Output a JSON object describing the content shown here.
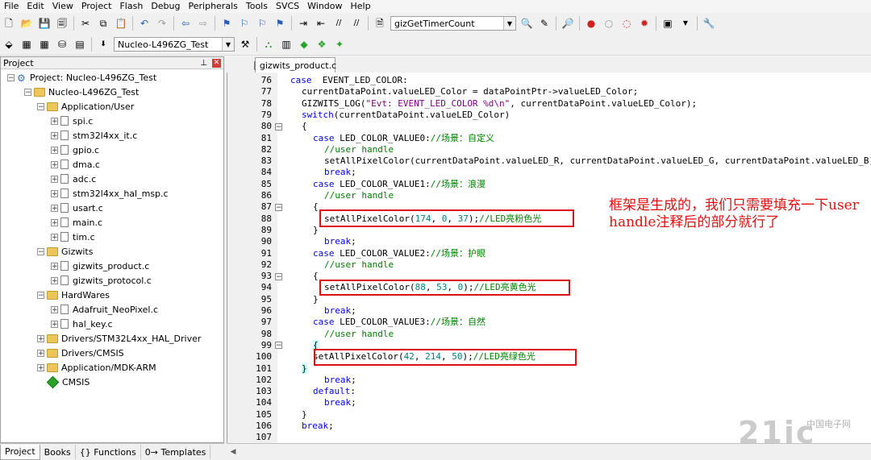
{
  "menubar": {
    "items": [
      "File",
      "Edit",
      "View",
      "Project",
      "Flash",
      "Debug",
      "Peripherals",
      "Tools",
      "SVCS",
      "Window",
      "Help"
    ]
  },
  "toolbar": {
    "function_combo": "gizGetTimerCount",
    "target_combo": "Nucleo-L496ZG_Test"
  },
  "project_panel": {
    "title": "Project",
    "tree": [
      {
        "label": "Project: Nucleo-L496ZG_Test",
        "level": 0,
        "kind": "project",
        "exp": "-"
      },
      {
        "label": "Nucleo-L496ZG_Test",
        "level": 1,
        "kind": "target",
        "exp": "-"
      },
      {
        "label": "Application/User",
        "level": 2,
        "kind": "folder",
        "exp": "-"
      },
      {
        "label": "spi.c",
        "level": 3,
        "kind": "file",
        "exp": "+"
      },
      {
        "label": "stm32l4xx_it.c",
        "level": 3,
        "kind": "file",
        "exp": "+"
      },
      {
        "label": "gpio.c",
        "level": 3,
        "kind": "file",
        "exp": "+"
      },
      {
        "label": "dma.c",
        "level": 3,
        "kind": "file",
        "exp": "+"
      },
      {
        "label": "adc.c",
        "level": 3,
        "kind": "file",
        "exp": "+"
      },
      {
        "label": "stm32l4xx_hal_msp.c",
        "level": 3,
        "kind": "file",
        "exp": "+"
      },
      {
        "label": "usart.c",
        "level": 3,
        "kind": "file",
        "exp": "+"
      },
      {
        "label": "main.c",
        "level": 3,
        "kind": "file",
        "exp": "+"
      },
      {
        "label": "tim.c",
        "level": 3,
        "kind": "file",
        "exp": "+"
      },
      {
        "label": "Gizwits",
        "level": 2,
        "kind": "folder",
        "exp": "-"
      },
      {
        "label": "gizwits_product.c",
        "level": 3,
        "kind": "file",
        "exp": "+"
      },
      {
        "label": "gizwits_protocol.c",
        "level": 3,
        "kind": "file",
        "exp": "+"
      },
      {
        "label": "HardWares",
        "level": 2,
        "kind": "folder",
        "exp": "-"
      },
      {
        "label": "Adafruit_NeoPixel.c",
        "level": 3,
        "kind": "file",
        "exp": "+"
      },
      {
        "label": "hal_key.c",
        "level": 3,
        "kind": "file",
        "exp": "+"
      },
      {
        "label": "Drivers/STM32L4xx_HAL_Driver",
        "level": 2,
        "kind": "folder",
        "exp": "+"
      },
      {
        "label": "Drivers/CMSIS",
        "level": 2,
        "kind": "folder",
        "exp": "+"
      },
      {
        "label": "Application/MDK-ARM",
        "level": 2,
        "kind": "folder",
        "exp": "+"
      },
      {
        "label": "CMSIS",
        "level": 2,
        "kind": "diamond",
        "exp": ""
      }
    ]
  },
  "bottom_tabs": [
    "Project",
    "Books",
    "{} Functions",
    "0→ Templates"
  ],
  "editor": {
    "tab_label": "gizwits_product.c",
    "lines": [
      {
        "n": "76",
        "fold": "",
        "indent": 0,
        "parts": [
          [
            "kw",
            "case"
          ],
          [
            "",
            "  EVENT_LED_COLOR:"
          ]
        ]
      },
      {
        "n": "77",
        "fold": "",
        "indent": 1,
        "parts": [
          [
            "",
            "currentDataPoint.valueLED_Color = dataPointPtr->valueLED_Color;"
          ]
        ]
      },
      {
        "n": "78",
        "fold": "",
        "indent": 1,
        "parts": [
          [
            "",
            "GIZWITS_LOG("
          ],
          [
            "str",
            "\"Evt: EVENT_LED_COLOR %d\\n\""
          ],
          [
            "",
            ", currentDataPoint.valueLED_Color);"
          ]
        ]
      },
      {
        "n": "79",
        "fold": "",
        "indent": 1,
        "parts": [
          [
            "kw",
            "switch"
          ],
          [
            "",
            "(currentDataPoint.valueLED_Color)"
          ]
        ]
      },
      {
        "n": "80",
        "fold": "-",
        "indent": 1,
        "parts": [
          [
            "",
            "{"
          ]
        ]
      },
      {
        "n": "81",
        "fold": "",
        "indent": 2,
        "parts": [
          [
            "kw",
            "case"
          ],
          [
            "",
            " LED_COLOR_VALUE0:"
          ],
          [
            "cm",
            "//场景：自定义"
          ]
        ]
      },
      {
        "n": "82",
        "fold": "",
        "indent": 3,
        "parts": [
          [
            "cm",
            "//user handle"
          ]
        ]
      },
      {
        "n": "83",
        "fold": "",
        "indent": 3,
        "parts": [
          [
            "",
            "setAllPixelColor(currentDataPoint.valueLED_R, currentDataPoint.valueLED_G, currentDataPoint.valueLED_B);"
          ]
        ]
      },
      {
        "n": "84",
        "fold": "",
        "indent": 3,
        "parts": [
          [
            "kw",
            "break"
          ],
          [
            "",
            ";"
          ]
        ]
      },
      {
        "n": "85",
        "fold": "",
        "indent": 2,
        "parts": [
          [
            "kw",
            "case"
          ],
          [
            "",
            " LED_COLOR_VALUE1:"
          ],
          [
            "cm",
            "//场景：浪漫"
          ]
        ]
      },
      {
        "n": "86",
        "fold": "",
        "indent": 3,
        "parts": [
          [
            "cm",
            "//user handle"
          ]
        ]
      },
      {
        "n": "87",
        "fold": "-",
        "indent": 2,
        "parts": [
          [
            "",
            "{"
          ]
        ]
      },
      {
        "n": "88",
        "fold": "",
        "indent": 3,
        "parts": [
          [
            "",
            "setAllPixelColor("
          ],
          [
            "num",
            "174"
          ],
          [
            "",
            ", "
          ],
          [
            "num",
            "0"
          ],
          [
            "",
            ", "
          ],
          [
            "num",
            "37"
          ],
          [
            "",
            ");"
          ],
          [
            "cm",
            "//LED亮粉色光"
          ]
        ]
      },
      {
        "n": "89",
        "fold": "",
        "indent": 2,
        "parts": [
          [
            "",
            "}"
          ]
        ]
      },
      {
        "n": "90",
        "fold": "",
        "indent": 3,
        "parts": [
          [
            "kw",
            "break"
          ],
          [
            "",
            ";"
          ]
        ]
      },
      {
        "n": "91",
        "fold": "",
        "indent": 2,
        "parts": [
          [
            "kw",
            "case"
          ],
          [
            "",
            " LED_COLOR_VALUE2:"
          ],
          [
            "cm",
            "//场景：护眼"
          ]
        ]
      },
      {
        "n": "92",
        "fold": "",
        "indent": 3,
        "parts": [
          [
            "cm",
            "//user handle"
          ]
        ]
      },
      {
        "n": "93",
        "fold": "-",
        "indent": 2,
        "parts": [
          [
            "",
            "{"
          ]
        ]
      },
      {
        "n": "94",
        "fold": "",
        "indent": 3,
        "parts": [
          [
            "",
            "setAllPixelColor("
          ],
          [
            "num",
            "88"
          ],
          [
            "",
            ", "
          ],
          [
            "num",
            "53"
          ],
          [
            "",
            ", "
          ],
          [
            "num",
            "0"
          ],
          [
            "",
            ");"
          ],
          [
            "cm",
            "//LED亮黄色光"
          ]
        ]
      },
      {
        "n": "95",
        "fold": "",
        "indent": 2,
        "parts": [
          [
            "",
            "}"
          ]
        ]
      },
      {
        "n": "96",
        "fold": "",
        "indent": 3,
        "parts": [
          [
            "kw",
            "break"
          ],
          [
            "",
            ";"
          ]
        ]
      },
      {
        "n": "97",
        "fold": "",
        "indent": 2,
        "parts": [
          [
            "kw",
            "case"
          ],
          [
            "",
            " LED_COLOR_VALUE3:"
          ],
          [
            "cm",
            "//场景：自然"
          ]
        ]
      },
      {
        "n": "98",
        "fold": "",
        "indent": 3,
        "parts": [
          [
            "cm",
            "//user handle"
          ]
        ]
      },
      {
        "n": "99",
        "fold": "-",
        "indent": 2,
        "hl": true,
        "parts": [
          [
            "",
            "{"
          ]
        ]
      },
      {
        "n": "100",
        "fold": "",
        "indent": 2,
        "parts": [
          [
            "",
            "setAllPixelColor("
          ],
          [
            "num",
            "42"
          ],
          [
            "",
            ", "
          ],
          [
            "num",
            "214"
          ],
          [
            "",
            ", "
          ],
          [
            "num",
            "50"
          ],
          [
            "",
            ");"
          ],
          [
            "cm",
            "//LED亮绿色光"
          ]
        ]
      },
      {
        "n": "101",
        "fold": "",
        "indent": 1,
        "hl": true,
        "parts": [
          [
            "",
            "}"
          ]
        ]
      },
      {
        "n": "102",
        "fold": "",
        "indent": 3,
        "parts": [
          [
            "kw",
            "break"
          ],
          [
            "",
            ";"
          ]
        ]
      },
      {
        "n": "103",
        "fold": "",
        "indent": 2,
        "parts": [
          [
            "kw",
            "default"
          ],
          [
            "",
            ":"
          ]
        ]
      },
      {
        "n": "104",
        "fold": "",
        "indent": 3,
        "parts": [
          [
            "kw",
            "break"
          ],
          [
            "",
            ";"
          ]
        ]
      },
      {
        "n": "105",
        "fold": "",
        "indent": 1,
        "parts": [
          [
            "",
            "}"
          ]
        ]
      },
      {
        "n": "106",
        "fold": "",
        "indent": 1,
        "parts": [
          [
            "kw",
            "break"
          ],
          [
            "",
            ";"
          ]
        ]
      },
      {
        "n": "107",
        "fold": "",
        "indent": 0,
        "parts": []
      }
    ]
  },
  "annotation": "框架是生成的，我们只需要填充一下user handle注释后的部分就行了",
  "watermark": {
    "main": "21ic",
    "sub": "中国电子网"
  },
  "colors": {
    "keyword": "#0000ff",
    "comment": "#008000",
    "string": "#800080",
    "number": "#008080",
    "redbox": "#e01010"
  }
}
